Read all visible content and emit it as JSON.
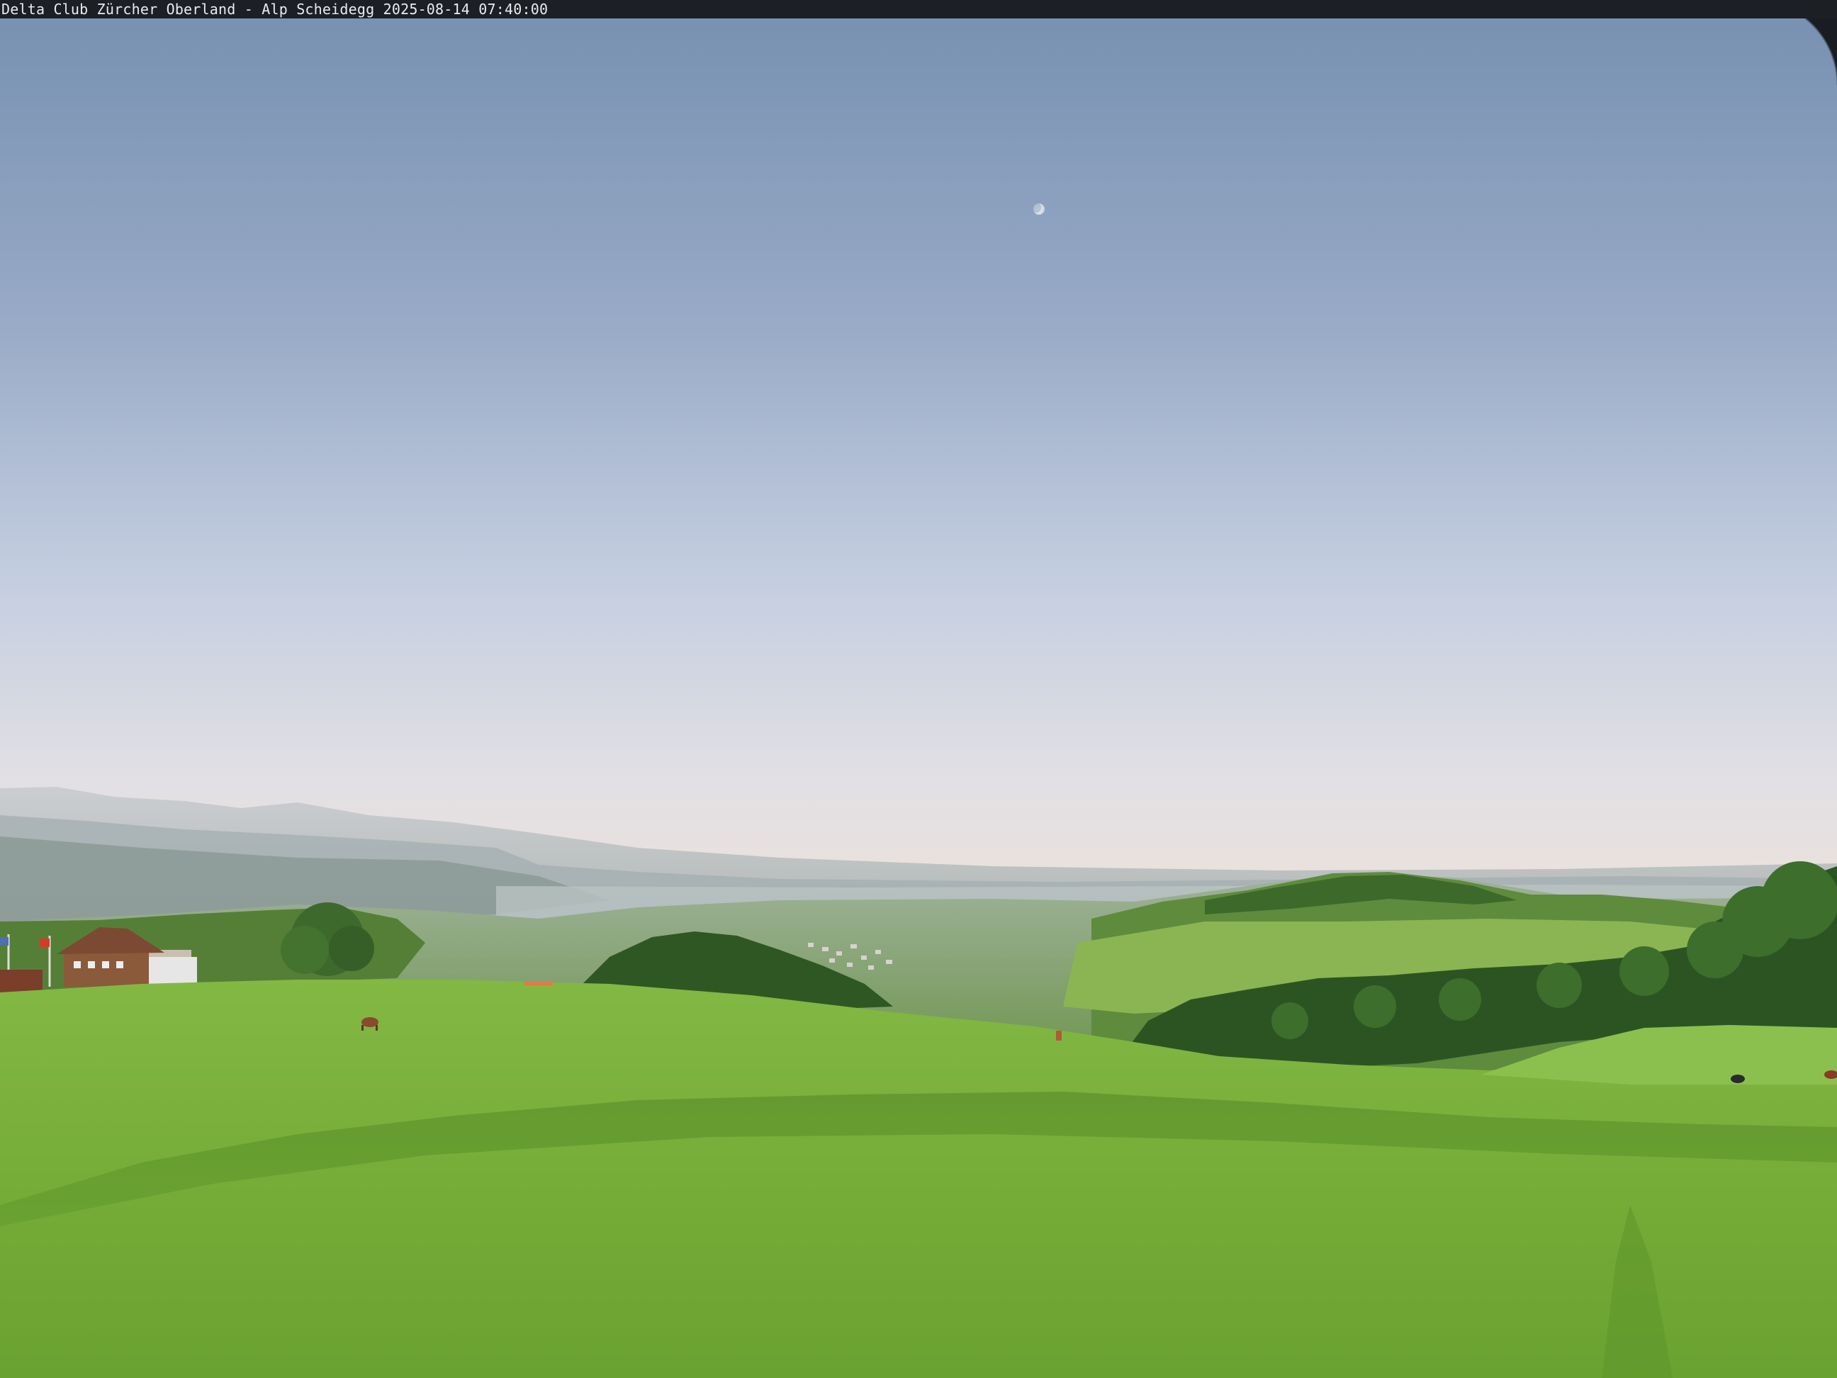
{
  "webcam": {
    "caption": "Delta Club Zürcher Oberland - Alp Scheidegg 2025-08-14 07:40:00"
  },
  "colors": {
    "sky_top": "#7b94b4",
    "sky_mid": "#a9b8d1",
    "sky_horizon": "#e8e2dc",
    "haze": "#c9cdd0",
    "meadow_light": "#7bb23e",
    "meadow_dark": "#5a8f2a",
    "forest": "#2f5a24",
    "caption_bar": "#1c1f24"
  }
}
